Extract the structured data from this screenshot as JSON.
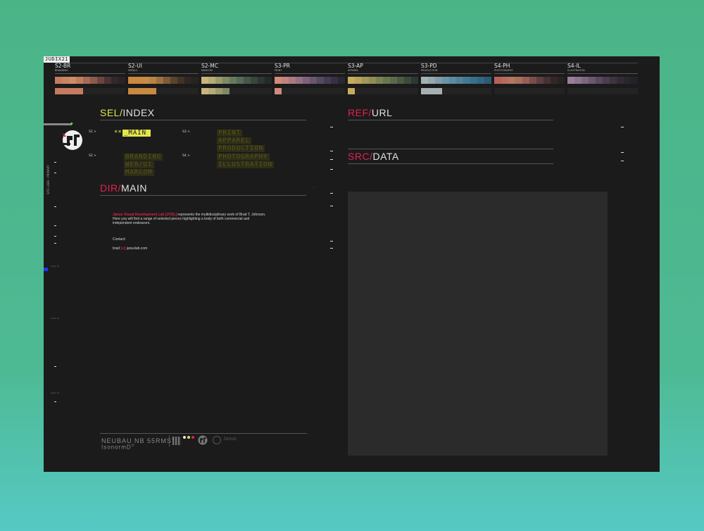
{
  "logo_tag": "JUDIX21",
  "palettes": [
    {
      "code": "S2-BR",
      "sub": "BRANDING",
      "row1": [
        "#c57b5f",
        "#c9855f",
        "#cd8c66",
        "#c07c62",
        "#a86a58",
        "#8e5a4d",
        "#6a4640",
        "#4a3432",
        "#33272a",
        "#2a2324"
      ],
      "row2": [
        "#c57b5f",
        "#c57b5f",
        "#c57b5f",
        "#c57b5f"
      ]
    },
    {
      "code": "S2-UI",
      "sub": "WEB/UI",
      "row1": [
        "#c9893f",
        "#c9893f",
        "#c68c47",
        "#b88342",
        "#9e7040",
        "#7c5a38",
        "#5a4430",
        "#403327",
        "#2f2721",
        "#28231f"
      ],
      "row2": [
        "#c9893f",
        "#c9893f",
        "#c9893f",
        "#c9893f"
      ]
    },
    {
      "code": "S2-MC",
      "sub": "MARCOM",
      "row1": [
        "#c9b47d",
        "#b6aa77",
        "#9b9a6d",
        "#7f8964",
        "#677a5d",
        "#566b55",
        "#45574a",
        "#37463e",
        "#2c3633",
        "#25292a"
      ],
      "row2": [
        "#c9b47d",
        "#b6aa77",
        "#9b9a6d",
        "#7f8964"
      ]
    },
    {
      "code": "S3-PR",
      "sub": "PRINT",
      "row1": [
        "#d18a7c",
        "#c1837f",
        "#ac7980",
        "#97707f",
        "#7f627a",
        "#6a5570",
        "#574863",
        "#463c53",
        "#363142",
        "#2a2733"
      ],
      "row2": [
        "#d18a7c"
      ]
    },
    {
      "code": "S3-AP",
      "sub": "APPAREL",
      "row1": [
        "#c6ac5e",
        "#b6a25b",
        "#a29858",
        "#8e8d55",
        "#7b8252",
        "#6a764f",
        "#5a6a4b",
        "#4a5b44",
        "#3b4a3b",
        "#2d3830"
      ],
      "row2": [
        "#c6ac5e"
      ]
    },
    {
      "code": "S3-PD",
      "sub": "PRODUCTION",
      "row1": [
        "#a5b0b2",
        "#95a8ad",
        "#7f9da8",
        "#6d94a3",
        "#5b8b9e",
        "#4f8299",
        "#437892",
        "#3a6f8a",
        "#326580",
        "#2b5a74"
      ],
      "row2": [
        "#a5b0b2",
        "#a5b0b2",
        "#a5b0b2"
      ]
    },
    {
      "code": "S4-PH",
      "sub": "PHOTOGRAPHY",
      "row1": [
        "#b6625b",
        "#b86b5c",
        "#b5765f",
        "#a86f5d",
        "#945f55",
        "#7a4e4a",
        "#5f3e3e",
        "#473133",
        "#342628",
        "#292122"
      ],
      "row2": []
    },
    {
      "code": "S4-IL",
      "sub": "ILLUSTRATION",
      "row1": [
        "#9b7f99",
        "#8e738d",
        "#7c6680",
        "#6a5870",
        "#594a60",
        "#4a3e50",
        "#3d3442",
        "#322b36",
        "#2a252d",
        "#242127"
      ],
      "row2": []
    }
  ],
  "vertical_label": "SITE LABS - PRIMARY",
  "rail_labels": [
    "0001-01",
    "0001-02",
    "0001-03"
  ],
  "sel": {
    "prefix": "SEL/",
    "title": "INDEX"
  },
  "ref": {
    "prefix": "REF/",
    "title": "URL"
  },
  "src": {
    "prefix": "SRC/",
    "title": "DATA"
  },
  "dir": {
    "prefix": "DIR/",
    "title": "MAIN"
  },
  "index": {
    "s1": "S1 >",
    "s2": "S2 >",
    "s3": "S3 >",
    "s4": "S4 >",
    "stars": "**",
    "main": "_MAIN",
    "s2_items": [
      "BRANDING",
      "WEB/UI",
      "MARCOM"
    ],
    "s3_items": [
      "PRINT",
      "APPAREL",
      "PRODUCTION"
    ],
    "s4_items": [
      "PHOTOGRAPHY",
      "ILLUSTRATION"
    ]
  },
  "body": {
    "highlight": "Janus Visual Development Lab [JVDL]",
    "text": " represents the multidisciplinary work of Brad T. Johnson. Here you will find a range of selected pieces highlighting a body of both commercial and independent endeavors.",
    "contact_label": "Contact:",
    "email_user": "brad ",
    "email_at": "[at]",
    "email_domain": " januslab.com"
  },
  "footer": {
    "brand": "NEUBAU NB 55RMS",
    "brand_mark": "©",
    "sub": "IsonormD",
    "sub_mark": "©",
    "word": "Janus",
    "dot_colors": [
      "#f0f0f0",
      "#e3e64a",
      "#e0224d"
    ]
  }
}
